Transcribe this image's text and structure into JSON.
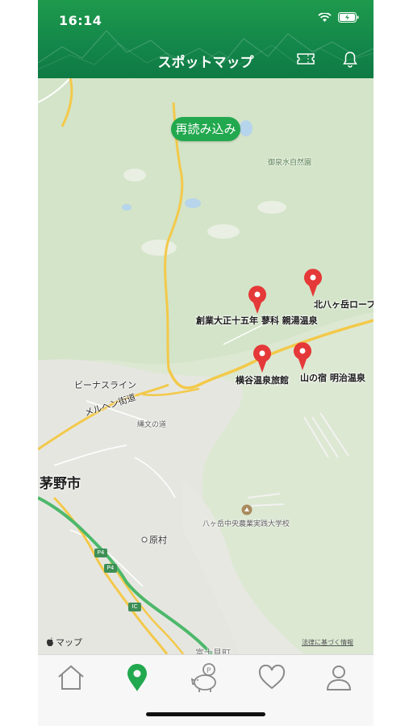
{
  "status_bar": {
    "time": "16:14"
  },
  "header": {
    "title": "スポットマップ",
    "ticket_icon": "ticket-icon",
    "bell_icon": "bell-icon"
  },
  "map": {
    "reload_label": "再読み込み",
    "attribution": "マップ",
    "legal": "法律に基づく情報",
    "place_labels": {
      "park": "御泉水自然園",
      "venus": "ビーナスライン",
      "merhen": "メルヘン街道",
      "jomon": "縄文の道",
      "chino": "茅野市",
      "harumura": "原村",
      "school": "八ヶ岳中央農業実践大学校",
      "bottom": "富士見町"
    },
    "shields": {
      "p4a": "P4",
      "p4b": "P4",
      "ic": "IC"
    },
    "spots": [
      {
        "label": "創業大正十五年 蓼科 親湯温泉"
      },
      {
        "label": "北八ヶ岳ロープ"
      },
      {
        "label": "横谷温泉旅館"
      },
      {
        "label": "山の宿 明治温泉"
      }
    ]
  },
  "tabbar": {
    "tabs": [
      {
        "icon": "home-icon",
        "active": false
      },
      {
        "icon": "map-pin-icon",
        "active": true
      },
      {
        "icon": "piggy-bank-icon",
        "active": false
      },
      {
        "icon": "heart-icon",
        "active": false
      },
      {
        "icon": "person-icon",
        "active": false
      }
    ]
  },
  "colors": {
    "brand_green": "#1e9a4c",
    "pin_red": "#e53838",
    "active_tab": "#22a84e",
    "inactive_tab": "#8a8a8a"
  }
}
